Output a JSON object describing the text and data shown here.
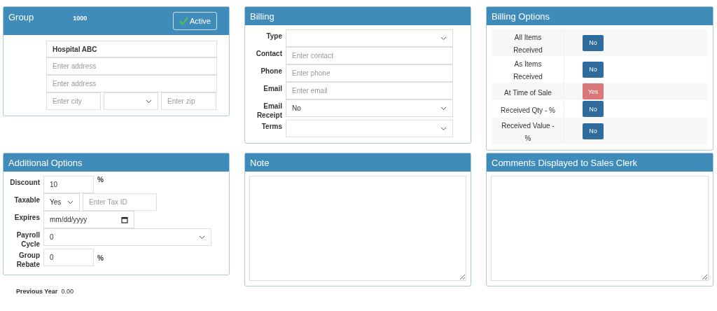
{
  "group": {
    "title": "Group",
    "number": "1000",
    "active": {
      "label": "Active",
      "checked": true
    },
    "name": "Hospital ABC",
    "address_placeholders": [
      "Enter address",
      "Enter address"
    ],
    "city_placeholder": "Enter city",
    "zip_placeholder": "Enter zip"
  },
  "billing": {
    "title": "Billing",
    "fields": [
      {
        "label": "Type",
        "kind": "select"
      },
      {
        "label": "Contact",
        "kind": "input",
        "placeholder": "Enter contact"
      },
      {
        "label": "Phone",
        "kind": "input",
        "placeholder": "Enter phone"
      },
      {
        "label": "Email",
        "kind": "input",
        "placeholder": "Enter email"
      },
      {
        "label": "Email Receipt",
        "kind": "select",
        "value": "No"
      },
      {
        "label": "Terms",
        "kind": "select"
      }
    ]
  },
  "billing_options": {
    "title": "Billing Options",
    "rows": [
      {
        "label": "All Items Received",
        "value": "No",
        "on": false
      },
      {
        "label": "As Items Received",
        "value": "No",
        "on": false
      },
      {
        "label": "At Time of Sale",
        "value": "Yes",
        "on": true
      },
      {
        "label": "Received Qty - %",
        "value": "No",
        "on": false
      },
      {
        "label": "Received Value - %",
        "value": "No",
        "on": false
      }
    ]
  },
  "additional_options": {
    "title": "Additional Options",
    "fields": [
      {
        "label": "Discount",
        "kind": "percent",
        "value": "10",
        "suffix": "%"
      },
      {
        "label": "Taxable",
        "kind": "tax",
        "value": "Yes",
        "placeholder": "Enter Tax ID"
      },
      {
        "label": "Expires",
        "kind": "date",
        "placeholder": "mm/dd/yyyy"
      },
      {
        "label": "Payroll Cycle",
        "kind": "select",
        "value": "0"
      },
      {
        "label": "Group Rebate",
        "kind": "percent",
        "value": "0",
        "suffix": "%"
      }
    ]
  },
  "note": {
    "title": "Note"
  },
  "comments": {
    "title": "Comments Displayed to Sales Clerk"
  },
  "previous_year": {
    "label": "Previous Year",
    "value": "0.00"
  }
}
